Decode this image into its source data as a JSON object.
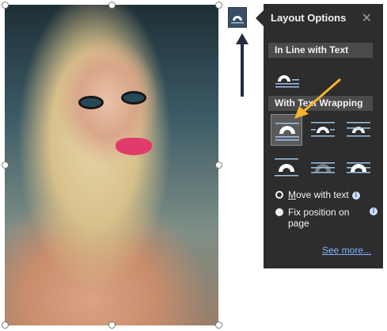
{
  "picture": {
    "alt": "portrait-photo"
  },
  "panel": {
    "title": "Layout Options",
    "close_icon": "close-icon",
    "inline_section": "In Line with Text",
    "wrap_section": "With Text Wrapping",
    "wrap_options": [
      "square",
      "tight",
      "through",
      "top-and-bottom",
      "behind-text",
      "in-front-of-text"
    ],
    "selected_wrap": "square",
    "radio_move": "Move with text",
    "radio_move_underline": "M",
    "radio_fix_line1": "Fix position on",
    "radio_fix_line2": "page",
    "selected_radio": "move",
    "see_more": "See more..."
  },
  "colors": {
    "panel_bg": "#2d2d2d",
    "section_bg": "#4b4b4b",
    "link": "#7fb3ff",
    "callout_arrow": "#f2b52a",
    "pointer_arrow": "#1f2d3d"
  }
}
